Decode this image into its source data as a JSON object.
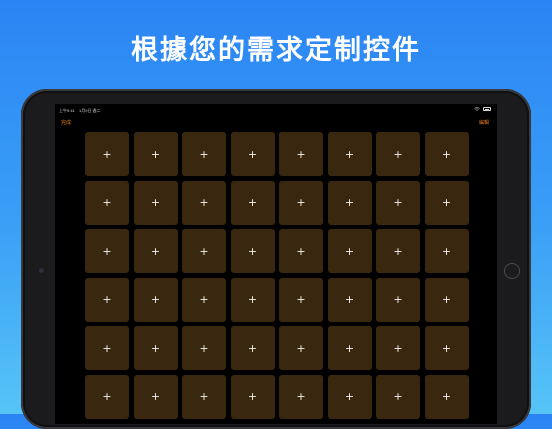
{
  "headline": "根據您的需求定制控件",
  "status_bar": {
    "time": "上午9:41",
    "date": "1月9日 週二"
  },
  "nav": {
    "left_label": "完成",
    "right_label": "編輯"
  },
  "grid": {
    "columns": 8,
    "visible_rows": 6,
    "tile_icon": "plus-icon",
    "tile_symbol": "+",
    "tile_color": "#3a2710"
  },
  "colors": {
    "accent": "#e07a20",
    "background_top": "#2b84f4",
    "background_bottom": "#57c4f7"
  }
}
